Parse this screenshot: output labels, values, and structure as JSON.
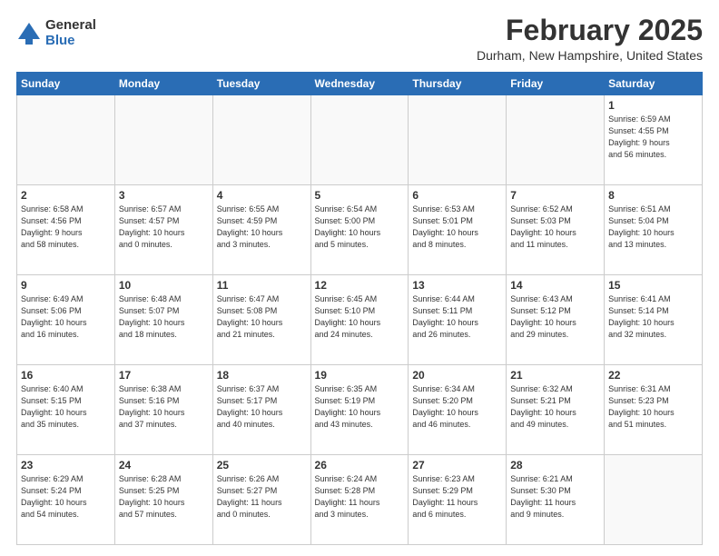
{
  "logo": {
    "general": "General",
    "blue": "Blue"
  },
  "title": "February 2025",
  "location": "Durham, New Hampshire, United States",
  "days_of_week": [
    "Sunday",
    "Monday",
    "Tuesday",
    "Wednesday",
    "Thursday",
    "Friday",
    "Saturday"
  ],
  "weeks": [
    [
      {
        "day": "",
        "info": ""
      },
      {
        "day": "",
        "info": ""
      },
      {
        "day": "",
        "info": ""
      },
      {
        "day": "",
        "info": ""
      },
      {
        "day": "",
        "info": ""
      },
      {
        "day": "",
        "info": ""
      },
      {
        "day": "1",
        "info": "Sunrise: 6:59 AM\nSunset: 4:55 PM\nDaylight: 9 hours\nand 56 minutes."
      }
    ],
    [
      {
        "day": "2",
        "info": "Sunrise: 6:58 AM\nSunset: 4:56 PM\nDaylight: 9 hours\nand 58 minutes."
      },
      {
        "day": "3",
        "info": "Sunrise: 6:57 AM\nSunset: 4:57 PM\nDaylight: 10 hours\nand 0 minutes."
      },
      {
        "day": "4",
        "info": "Sunrise: 6:55 AM\nSunset: 4:59 PM\nDaylight: 10 hours\nand 3 minutes."
      },
      {
        "day": "5",
        "info": "Sunrise: 6:54 AM\nSunset: 5:00 PM\nDaylight: 10 hours\nand 5 minutes."
      },
      {
        "day": "6",
        "info": "Sunrise: 6:53 AM\nSunset: 5:01 PM\nDaylight: 10 hours\nand 8 minutes."
      },
      {
        "day": "7",
        "info": "Sunrise: 6:52 AM\nSunset: 5:03 PM\nDaylight: 10 hours\nand 11 minutes."
      },
      {
        "day": "8",
        "info": "Sunrise: 6:51 AM\nSunset: 5:04 PM\nDaylight: 10 hours\nand 13 minutes."
      }
    ],
    [
      {
        "day": "9",
        "info": "Sunrise: 6:49 AM\nSunset: 5:06 PM\nDaylight: 10 hours\nand 16 minutes."
      },
      {
        "day": "10",
        "info": "Sunrise: 6:48 AM\nSunset: 5:07 PM\nDaylight: 10 hours\nand 18 minutes."
      },
      {
        "day": "11",
        "info": "Sunrise: 6:47 AM\nSunset: 5:08 PM\nDaylight: 10 hours\nand 21 minutes."
      },
      {
        "day": "12",
        "info": "Sunrise: 6:45 AM\nSunset: 5:10 PM\nDaylight: 10 hours\nand 24 minutes."
      },
      {
        "day": "13",
        "info": "Sunrise: 6:44 AM\nSunset: 5:11 PM\nDaylight: 10 hours\nand 26 minutes."
      },
      {
        "day": "14",
        "info": "Sunrise: 6:43 AM\nSunset: 5:12 PM\nDaylight: 10 hours\nand 29 minutes."
      },
      {
        "day": "15",
        "info": "Sunrise: 6:41 AM\nSunset: 5:14 PM\nDaylight: 10 hours\nand 32 minutes."
      }
    ],
    [
      {
        "day": "16",
        "info": "Sunrise: 6:40 AM\nSunset: 5:15 PM\nDaylight: 10 hours\nand 35 minutes."
      },
      {
        "day": "17",
        "info": "Sunrise: 6:38 AM\nSunset: 5:16 PM\nDaylight: 10 hours\nand 37 minutes."
      },
      {
        "day": "18",
        "info": "Sunrise: 6:37 AM\nSunset: 5:17 PM\nDaylight: 10 hours\nand 40 minutes."
      },
      {
        "day": "19",
        "info": "Sunrise: 6:35 AM\nSunset: 5:19 PM\nDaylight: 10 hours\nand 43 minutes."
      },
      {
        "day": "20",
        "info": "Sunrise: 6:34 AM\nSunset: 5:20 PM\nDaylight: 10 hours\nand 46 minutes."
      },
      {
        "day": "21",
        "info": "Sunrise: 6:32 AM\nSunset: 5:21 PM\nDaylight: 10 hours\nand 49 minutes."
      },
      {
        "day": "22",
        "info": "Sunrise: 6:31 AM\nSunset: 5:23 PM\nDaylight: 10 hours\nand 51 minutes."
      }
    ],
    [
      {
        "day": "23",
        "info": "Sunrise: 6:29 AM\nSunset: 5:24 PM\nDaylight: 10 hours\nand 54 minutes."
      },
      {
        "day": "24",
        "info": "Sunrise: 6:28 AM\nSunset: 5:25 PM\nDaylight: 10 hours\nand 57 minutes."
      },
      {
        "day": "25",
        "info": "Sunrise: 6:26 AM\nSunset: 5:27 PM\nDaylight: 11 hours\nand 0 minutes."
      },
      {
        "day": "26",
        "info": "Sunrise: 6:24 AM\nSunset: 5:28 PM\nDaylight: 11 hours\nand 3 minutes."
      },
      {
        "day": "27",
        "info": "Sunrise: 6:23 AM\nSunset: 5:29 PM\nDaylight: 11 hours\nand 6 minutes."
      },
      {
        "day": "28",
        "info": "Sunrise: 6:21 AM\nSunset: 5:30 PM\nDaylight: 11 hours\nand 9 minutes."
      },
      {
        "day": "",
        "info": ""
      }
    ]
  ]
}
